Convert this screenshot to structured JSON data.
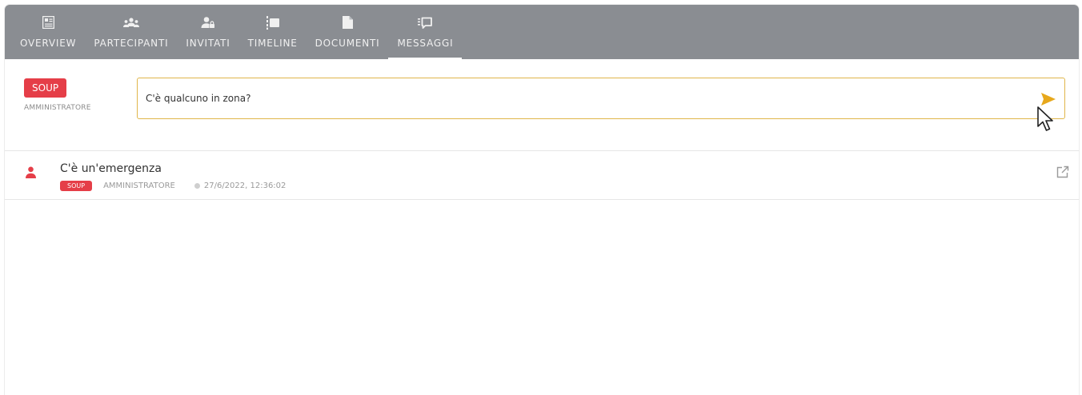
{
  "tabs": [
    {
      "label": "OVERVIEW",
      "icon": "overview-icon"
    },
    {
      "label": "PARTECIPANTI",
      "icon": "participants-icon"
    },
    {
      "label": "INVITATI",
      "icon": "invited-user-icon"
    },
    {
      "label": "TIMELINE",
      "icon": "timeline-icon"
    },
    {
      "label": "DOCUMENTI",
      "icon": "document-icon"
    },
    {
      "label": "MESSAGGI",
      "icon": "messages-icon"
    }
  ],
  "active_tab": "MESSAGGI",
  "composer": {
    "author_badge": "SOUP",
    "author_role": "AMMINISTRATORE",
    "input_value": "C'è qualcuno in zona?",
    "send_icon": "send-icon"
  },
  "messages": [
    {
      "title": "C'è un'emergenza",
      "badge": "SOUP",
      "role": "AMMINISTRATORE",
      "time": "27/6/2022, 12:36:02"
    }
  ],
  "colors": {
    "tab_bar": "#8a8d92",
    "badge": "#e53e48",
    "accent": "#e0b64a"
  }
}
